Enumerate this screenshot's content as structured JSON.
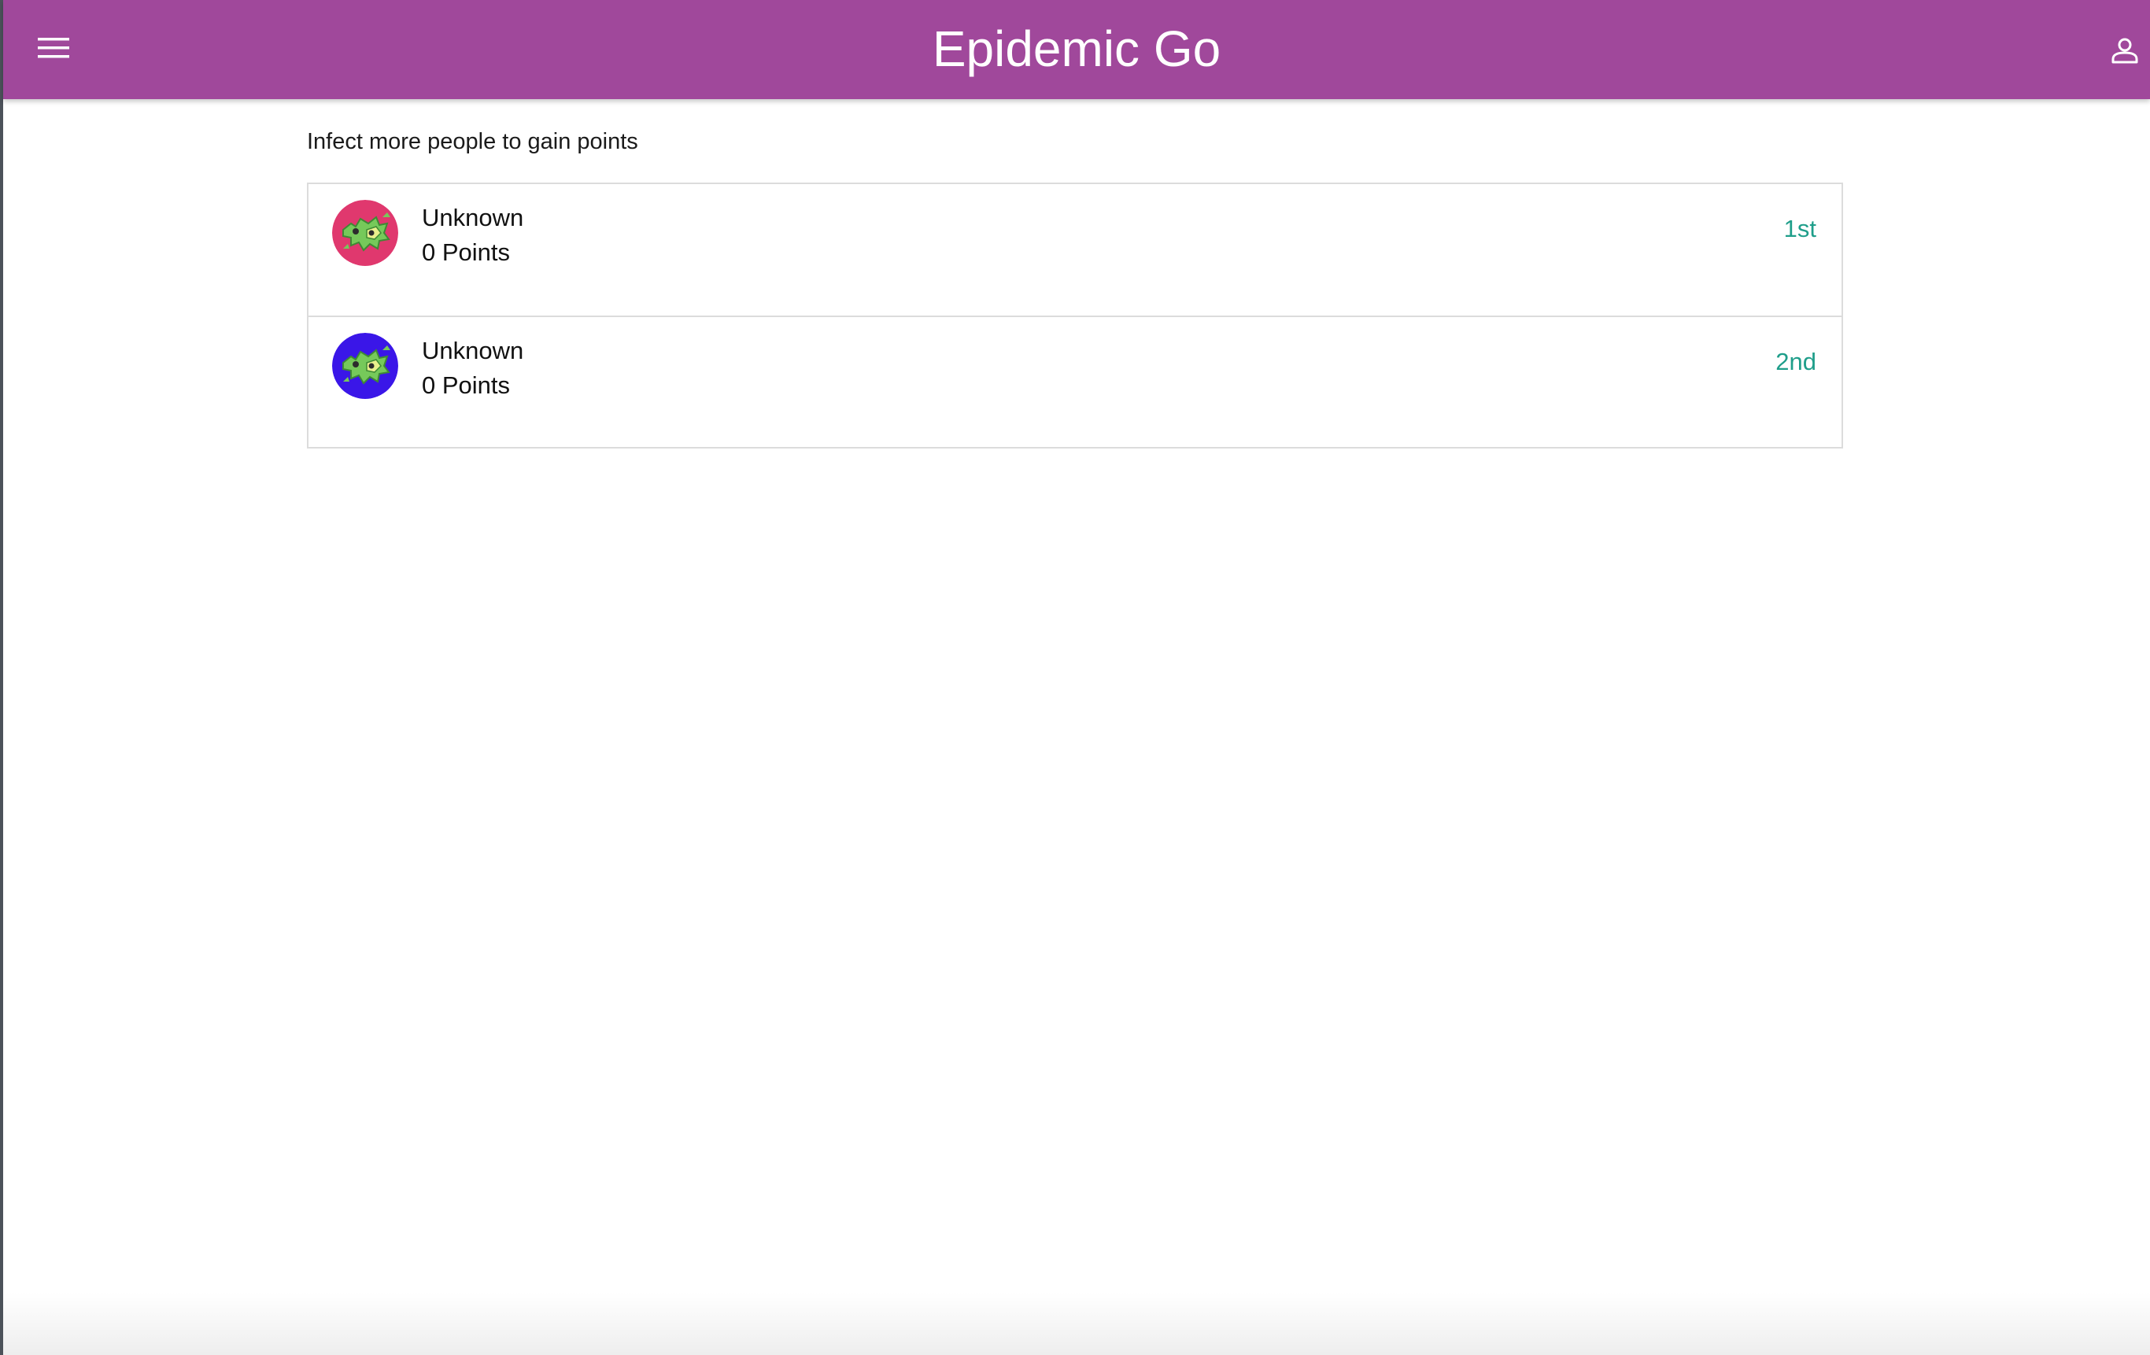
{
  "app": {
    "title": "Epidemic Go",
    "theme_color": "#a0489b",
    "icons": {
      "menu": "menu-icon",
      "account": "account-icon"
    }
  },
  "leaderboard": {
    "subtitle": "Infect more people to gain points",
    "rank_color": "#1f9e8a",
    "players": [
      {
        "name": "Unknown",
        "points": "0 Points",
        "rank": "1st",
        "avatar_color": "#e0386e",
        "avatar_icon": "virus-avatar-icon"
      },
      {
        "name": "Unknown",
        "points": "0 Points",
        "rank": "2nd",
        "avatar_color": "#3a16e8",
        "avatar_icon": "virus-avatar-icon"
      }
    ]
  }
}
